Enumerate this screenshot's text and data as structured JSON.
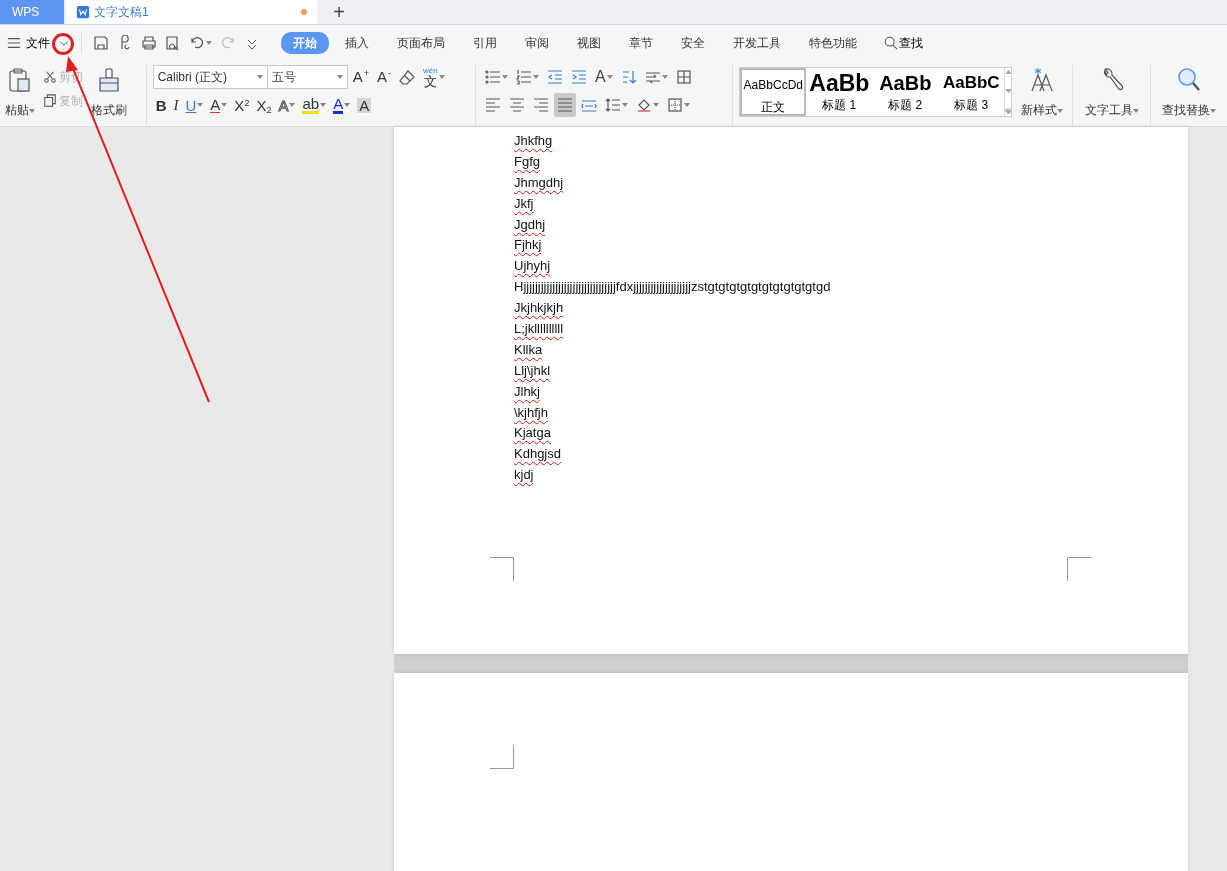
{
  "tab_bar": {
    "app_tab": "WPS",
    "document_tab": {
      "title": "文字文稿1",
      "unsaved": true
    },
    "new_tab_button": "+"
  },
  "menu_bar": {
    "menu_label": "文件",
    "quick_access": [
      {
        "disabled": false,
        "dropdown": false
      },
      {
        "disabled": false,
        "dropdown": false
      },
      {
        "disabled": false,
        "dropdown": false
      },
      {
        "disabled": false,
        "dropdown": false
      },
      {
        "disabled": false,
        "dropdown": true
      },
      {
        "disabled": true,
        "dropdown": false
      },
      {
        "disabled": false,
        "dropdown": false
      }
    ],
    "tabs": [
      {
        "label": "开始",
        "selected": true
      },
      {
        "label": "插入",
        "selected": false
      },
      {
        "label": "页面布局",
        "selected": false
      },
      {
        "label": "引用",
        "selected": false
      },
      {
        "label": "审阅",
        "selected": false
      },
      {
        "label": "视图",
        "selected": false
      },
      {
        "label": "章节",
        "selected": false
      },
      {
        "label": "安全",
        "selected": false
      },
      {
        "label": "开发工具",
        "selected": false
      },
      {
        "label": "特色功能",
        "selected": false
      }
    ],
    "search": "查找"
  },
  "ribbon": {
    "clipboard": {
      "paste": {
        "label": "粘贴",
        "dropdown": true
      },
      "cut": {
        "label": "剪切",
        "disabled": true
      },
      "copy": {
        "label": "复制",
        "disabled": true
      },
      "format_painter": {
        "label": "格式刷"
      }
    },
    "font": {
      "font_name": "Calibri (正文)",
      "font_size": "五号",
      "size_buttons": [
        {
          "label": "A$^{+}$"
        },
        {
          "label": "A$^{-}$"
        }
      ],
      "phonetic_button": {
        "ruby": "wén",
        "base": "文",
        "dropdown": true
      },
      "format_buttons": [
        {
          "label": "B",
          "dropdown": false
        },
        {
          "label": "I",
          "dropdown": false
        },
        {
          "label": "U",
          "dropdown": true
        },
        {
          "label": "A",
          "dropdown": true
        },
        {
          "label": "X$^{2}$",
          "dropdown": false
        },
        {
          "label": "X$_{2}$",
          "dropdown": false
        },
        {
          "label": "A",
          "dropdown": true
        },
        {
          "label": "ab",
          "dropdown": true
        },
        {
          "label": "A",
          "dropdown": true
        },
        {
          "label": "A",
          "dropdown": false
        }
      ]
    },
    "paragraph": {
      "rows": [
        [
          {
            "selected": false,
            "dropdown": true
          },
          {
            "selected": false,
            "dropdown": true
          },
          {
            "selected": false,
            "dropdown": false
          },
          {
            "selected": false,
            "dropdown": false
          },
          {
            "selected": false,
            "dropdown": true,
            "label": "A"
          },
          {
            "selected": false,
            "dropdown": false
          },
          {
            "selected": false,
            "dropdown": true
          },
          {
            "selected": false,
            "dropdown": false
          }
        ],
        [
          {
            "selected": false,
            "dropdown": false
          },
          {
            "selected": false,
            "dropdown": false
          },
          {
            "selected": false,
            "dropdown": false
          },
          {
            "selected": true,
            "dropdown": false
          },
          {
            "selected": false,
            "dropdown": false
          },
          {
            "selected": false,
            "dropdown": true
          },
          {
            "selected": false,
            "dropdown": true
          },
          {
            "selected": false,
            "dropdown": true
          }
        ]
      ]
    },
    "styles": {
      "items": [
        {
          "preview": "AaBbCcDd",
          "name": "正文",
          "selected": true
        },
        {
          "preview": "AaBb",
          "name": "标题 1",
          "selected": false
        },
        {
          "preview": "AaBb",
          "name": "标题 2",
          "selected": false
        },
        {
          "preview": "AaBbC",
          "name": "标题 3",
          "selected": false
        }
      ]
    },
    "new_style": {
      "label": "新样式",
      "dropdown": true
    },
    "text_tools": {
      "label": "文字工具",
      "dropdown": true
    },
    "find_replace": {
      "label": "查找替换",
      "dropdown": true
    }
  },
  "document": {
    "lines": [
      {
        "text": "Jhkfhg",
        "misspelled": true
      },
      {
        "text": "Fgfg",
        "misspelled": true
      },
      {
        "text": "Jhmgdhj",
        "misspelled": true
      },
      {
        "text": "Jkfj",
        "misspelled": true
      },
      {
        "text": "Jgdhj",
        "misspelled": true
      },
      {
        "text": "Fjhkj",
        "misspelled": true
      },
      {
        "text": "Ujhyhj",
        "misspelled": true
      },
      {
        "text": "Hjjjjjjjjjjjjjjjjjjjjjjjjjjjjjjjjfdxjjjjjjjjjjjjjjjjjjjjzstgtgtgtgtgtgtgtgtgtgtgd",
        "misspelled": false
      },
      {
        "text": "Jkjhkjkjh",
        "misspelled": true
      },
      {
        "text": "L;jkllllllllll",
        "misspelled": true
      },
      {
        "text": "Kllka",
        "misspelled": true
      },
      {
        "text": "Llj\\jhkl",
        "misspelled": true
      },
      {
        "text": "Jlhkj",
        "misspelled": true
      },
      {
        "text": "\\kjhfjh",
        "misspelled": true
      },
      {
        "text": "Kjatga",
        "misspelled": true
      },
      {
        "text": "Kdhgjsd",
        "misspelled": true
      },
      {
        "text": "kjdj",
        "misspelled": true
      }
    ]
  }
}
